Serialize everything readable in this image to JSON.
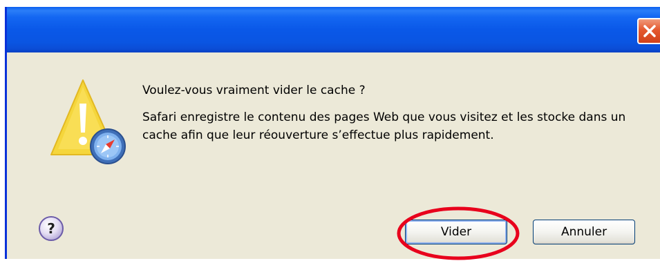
{
  "window": {
    "title": ""
  },
  "dialog": {
    "question": "Voulez-vous vraiment vider le cache ?",
    "message": "Safari enregistre le contenu des pages Web que vous visitez et les stocke dans un cache afin que leur réouverture s’effectue plus rapidement."
  },
  "buttons": {
    "confirm_label": "Vider",
    "cancel_label": "Annuler",
    "help_symbol": "?"
  },
  "icons": {
    "warning": "warning-triangle-safari-icon",
    "help": "help-icon",
    "close": "close-icon"
  },
  "colors": {
    "titlebar": "#0A58E8",
    "dialog_bg": "#ECE9D8",
    "close_button": "#E4582F",
    "warning_yellow": "#F5D63C",
    "highlight_ring": "#E8001C"
  }
}
